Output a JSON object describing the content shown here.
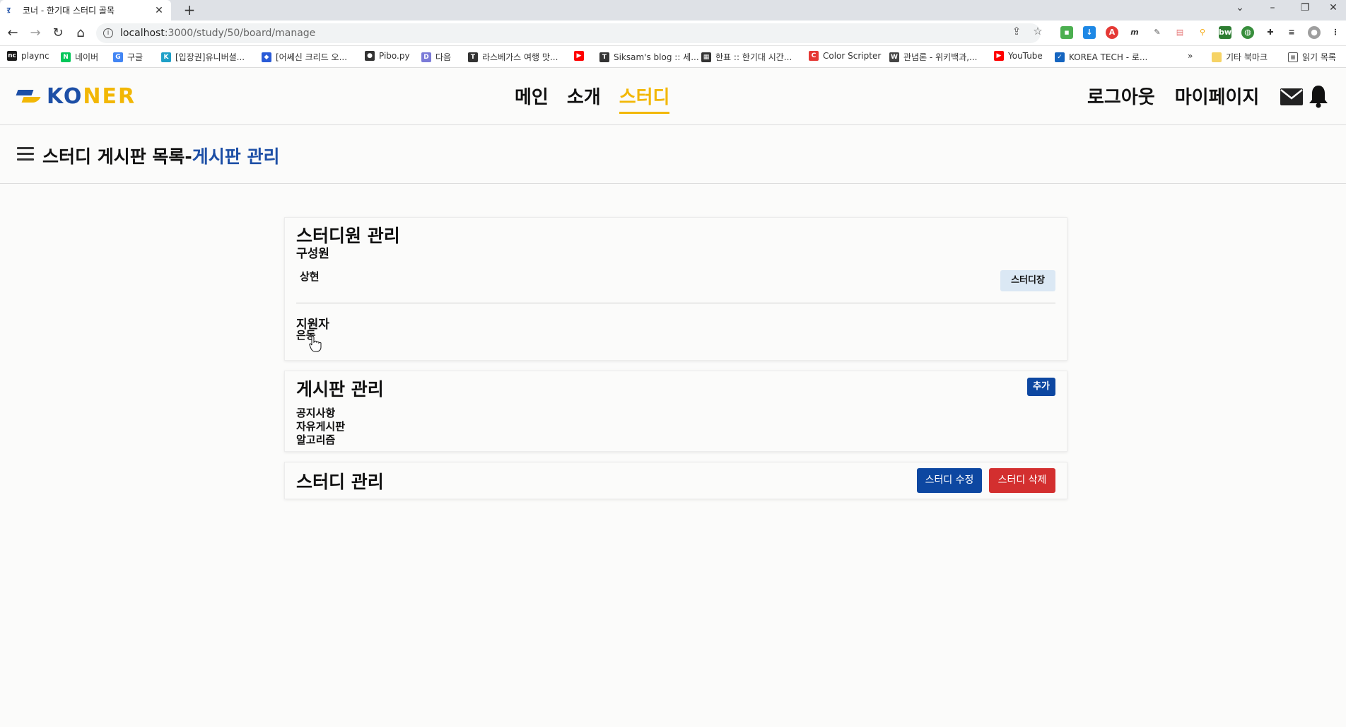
{
  "browser": {
    "tab": {
      "title": "코너 - 한기대 스터디 골목",
      "favicon": "koner-favicon"
    },
    "url": {
      "host": "localhost",
      "path": ":3000/study/50/board/manage"
    },
    "bookmarks": [
      {
        "label": "plaync",
        "icon_color": "#1a1a1a",
        "icon_text": "nc"
      },
      {
        "label": "네이버",
        "icon_color": "#03c75a",
        "icon_text": "N"
      },
      {
        "label": "구글",
        "icon_color": "#4285f4",
        "icon_text": "G"
      },
      {
        "label": "[입장권]유니버셜...",
        "icon_color": "#1fa0c8",
        "icon_text": "K"
      },
      {
        "label": "[어쎄신 크리드 오...",
        "icon_color": "#2a5bd7",
        "icon_text": "◆"
      },
      {
        "label": "Pibo.py",
        "icon_color": "#333333",
        "icon_text": "●"
      },
      {
        "label": "다음",
        "icon_color": "#7b7bd8",
        "icon_text": "D"
      },
      {
        "label": "라스베가스 여행 맛...",
        "icon_color": "#333333",
        "icon_text": "T"
      },
      {
        "label": "",
        "icon_color": "#ff0000",
        "icon_text": "▶"
      },
      {
        "label": "Siksam's blog :: 세...",
        "icon_color": "#333333",
        "icon_text": "T"
      },
      {
        "label": "한표 :: 한기대 시간...",
        "icon_color": "#333333",
        "icon_text": "▦"
      },
      {
        "label": "Color Scripter",
        "icon_color": "#e53935",
        "icon_text": "C"
      },
      {
        "label": "관념론 - 위키백과,...",
        "icon_color": "#444444",
        "icon_text": "W"
      },
      {
        "label": "YouTube",
        "icon_color": "#ff0000",
        "icon_text": "▶"
      },
      {
        "label": "KOREA TECH - 로...",
        "icon_color": "#1565c0",
        "icon_text": "✓"
      }
    ],
    "bookmarks_more": "»",
    "other_bookmarks": "기타 북마크",
    "reading_list": "읽기 목록"
  },
  "header": {
    "logo": {
      "ko": "KO",
      "ner": "NER"
    },
    "nav": {
      "main": "메인",
      "intro": "소개",
      "study": "스터디"
    },
    "user": {
      "logout": "로그아웃",
      "mypage": "마이페이지"
    }
  },
  "subheader": {
    "title_prefix": "스터디 게시판 목록-",
    "title_accent": "게시판 관리"
  },
  "members_card": {
    "title": "스터디원 관리",
    "members_label": "구성원",
    "members": [
      {
        "name": "상현",
        "role": "스터디장"
      }
    ],
    "applicants_label": "지원자",
    "applicants": [
      "은동"
    ]
  },
  "boards_card": {
    "title": "게시판 관리",
    "add_label": "추가",
    "boards": [
      "공지사항",
      "자유게시판",
      "알고리즘"
    ]
  },
  "study_card": {
    "title": "스터디 관리",
    "edit_label": "스터디 수정",
    "delete_label": "스터디 삭제"
  },
  "colors": {
    "brand_blue": "#1d4fa6",
    "brand_yellow": "#f2b705",
    "button_blue": "#0d47a1",
    "button_red": "#d32f2f",
    "badge_bg": "#dbe8f4"
  }
}
